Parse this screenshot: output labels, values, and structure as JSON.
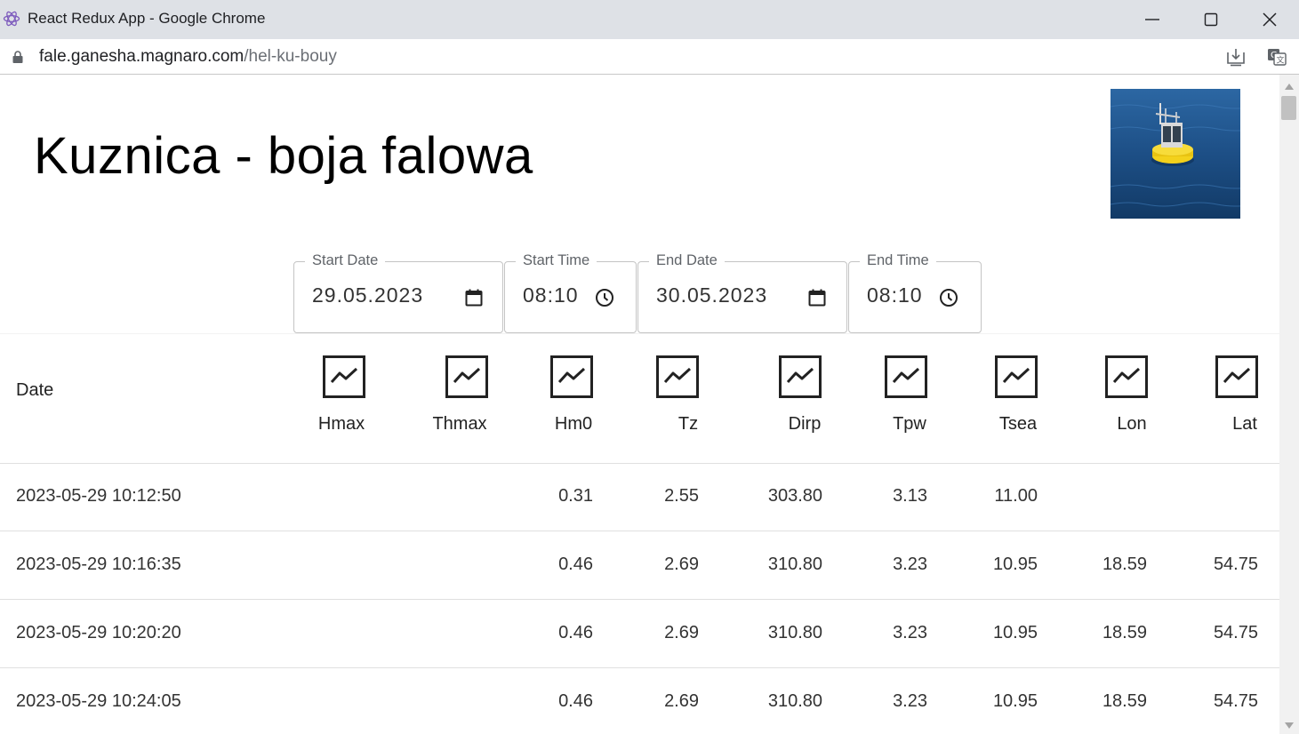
{
  "window": {
    "title": "React Redux App - Google Chrome"
  },
  "address_bar": {
    "host": "fale.ganesha.magnaro.com",
    "path": "/hel-ku-bouy"
  },
  "page": {
    "title": "Kuznica - boja falowa"
  },
  "filters": {
    "start_date": {
      "label": "Start Date",
      "value": "29.05.2023"
    },
    "start_time": {
      "label": "Start Time",
      "value": "08:10"
    },
    "end_date": {
      "label": "End Date",
      "value": "30.05.2023"
    },
    "end_time": {
      "label": "End Time",
      "value": "08:10"
    }
  },
  "table": {
    "date_header": "Date",
    "columns": [
      "Hmax",
      "Thmax",
      "Hm0",
      "Tz",
      "Dirp",
      "Tpw",
      "Tsea",
      "Lon",
      "Lat"
    ],
    "rows": [
      {
        "date": "2023-05-29 10:12:50",
        "Hmax": "",
        "Thmax": "",
        "Hm0": "0.31",
        "Tz": "2.55",
        "Dirp": "303.80",
        "Tpw": "3.13",
        "Tsea": "11.00",
        "Lon": "",
        "Lat": ""
      },
      {
        "date": "2023-05-29 10:16:35",
        "Hmax": "",
        "Thmax": "",
        "Hm0": "0.46",
        "Tz": "2.69",
        "Dirp": "310.80",
        "Tpw": "3.23",
        "Tsea": "10.95",
        "Lon": "18.59",
        "Lat": "54.75"
      },
      {
        "date": "2023-05-29 10:20:20",
        "Hmax": "",
        "Thmax": "",
        "Hm0": "0.46",
        "Tz": "2.69",
        "Dirp": "310.80",
        "Tpw": "3.23",
        "Tsea": "10.95",
        "Lon": "18.59",
        "Lat": "54.75"
      },
      {
        "date": "2023-05-29 10:24:05",
        "Hmax": "",
        "Thmax": "",
        "Hm0": "0.46",
        "Tz": "2.69",
        "Dirp": "310.80",
        "Tpw": "3.23",
        "Tsea": "10.95",
        "Lon": "18.59",
        "Lat": "54.75"
      }
    ]
  },
  "icons": {
    "column_chart": "show-chart-icon",
    "date_picker": "calendar-icon",
    "time_picker": "clock-icon"
  },
  "colors": {
    "titlebar": "#dee1e6",
    "water": "#1d4f86",
    "buoy": "#f3d11b"
  }
}
